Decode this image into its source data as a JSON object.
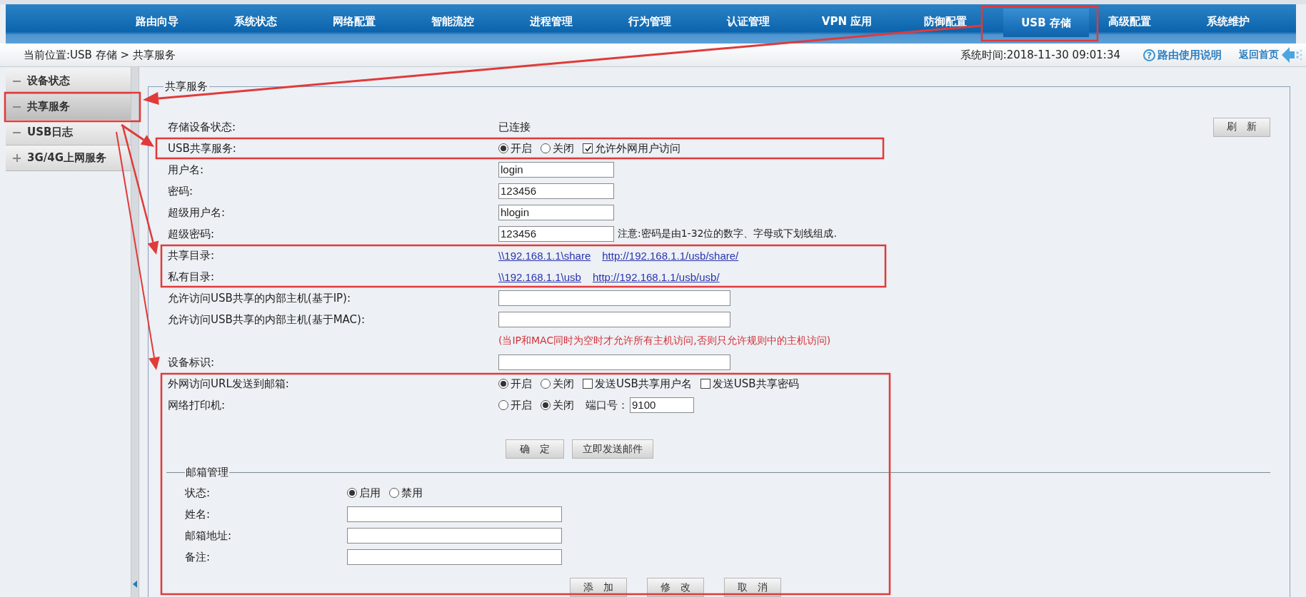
{
  "nav": [
    {
      "label": "路由向导",
      "selected": false
    },
    {
      "label": "系统状态",
      "selected": false
    },
    {
      "label": "网络配置",
      "selected": false
    },
    {
      "label": "智能流控",
      "selected": false
    },
    {
      "label": "进程管理",
      "selected": false
    },
    {
      "label": "行为管理",
      "selected": false
    },
    {
      "label": "认证管理",
      "selected": false
    },
    {
      "label": "VPN 应用",
      "selected": false
    },
    {
      "label": "防御配置",
      "selected": false
    },
    {
      "label": "USB 存储",
      "selected": true
    },
    {
      "label": "高级配置",
      "selected": false
    },
    {
      "label": "系统维护",
      "selected": false
    }
  ],
  "breadcrumb": "当前位置:USB 存储 > 共享服务",
  "system_time": "系统时间:2018-11-30 09:01:34",
  "help": {
    "icon": "?",
    "label": "路由使用说明"
  },
  "home_link": "返回首页",
  "sidebar": [
    {
      "label": "设备状态",
      "expanded": true,
      "selected": false
    },
    {
      "label": "共享服务",
      "expanded": true,
      "selected": true
    },
    {
      "label": "USB日志",
      "expanded": true,
      "selected": false
    },
    {
      "label": "3G/4G上网服务",
      "expanded": false,
      "selected": false
    }
  ],
  "panel": {
    "legend": "共享服务",
    "refresh_button": "刷　新",
    "rows": [
      {
        "kind": "text",
        "label": "存储设备状态:",
        "value": "已连接"
      },
      {
        "kind": "options",
        "label": "USB共享服务:",
        "options": [
          {
            "label": "开启",
            "selected": true
          },
          {
            "label": "关闭",
            "selected": false
          }
        ],
        "checkboxes": [
          {
            "label": "允许外网用户访问",
            "checked": true
          }
        ]
      },
      {
        "kind": "input",
        "label": "用户名:",
        "value": "login"
      },
      {
        "kind": "input",
        "label": "密码:",
        "value": "123456"
      },
      {
        "kind": "input",
        "label": "超级用户名:",
        "value": "hlogin"
      },
      {
        "kind": "input",
        "label": "超级密码:",
        "value": "123456",
        "note": "注意:密码是由1-32位的数字、字母或下划线组成."
      },
      {
        "kind": "links",
        "label": "共享目录:",
        "links": [
          "\\\\192.168.1.1\\share",
          "http://192.168.1.1/usb/share/"
        ]
      },
      {
        "kind": "links",
        "label": "私有目录:",
        "links": [
          "\\\\192.168.1.1\\usb",
          "http://192.168.1.1/usb/usb/"
        ]
      },
      {
        "kind": "wide_input",
        "label": "允许访问USB共享的内部主机(基于IP):"
      },
      {
        "kind": "wide_input",
        "label": "允许访问USB共享的内部主机(基于MAC):"
      },
      {
        "kind": "note",
        "value": "(当IP和MAC同时为空时才允许所有主机访问,否则只允许规则中的主机访问)"
      },
      {
        "kind": "wide_input",
        "label": "设备标识:"
      },
      {
        "kind": "options",
        "label": "外网访问URL发送到邮箱:",
        "options": [
          {
            "label": "开启",
            "selected": true
          },
          {
            "label": "关闭",
            "selected": false
          }
        ],
        "checkboxes": [
          {
            "label": "发送USB共享用户名",
            "checked": false
          },
          {
            "label": "发送USB共享密码",
            "checked": false
          }
        ]
      },
      {
        "kind": "options",
        "label": "网络打印机:",
        "options": [
          {
            "label": "开启",
            "selected": false
          },
          {
            "label": "关闭",
            "selected": true
          }
        ],
        "port_label": "端口号：",
        "port_value": "9100"
      }
    ],
    "actions": [
      "确　定",
      "立即发送邮件"
    ],
    "mail": {
      "legend": "邮箱管理",
      "rows": [
        {
          "kind": "options",
          "label": "状态:",
          "options": [
            {
              "label": "启用",
              "selected": true
            },
            {
              "label": "禁用",
              "selected": false
            }
          ]
        },
        {
          "kind": "input",
          "label": "姓名:"
        },
        {
          "kind": "input",
          "label": "邮箱地址:"
        },
        {
          "kind": "input",
          "label": "备注:"
        }
      ],
      "buttons": [
        "添　加",
        "修　改",
        "取　消"
      ]
    }
  }
}
